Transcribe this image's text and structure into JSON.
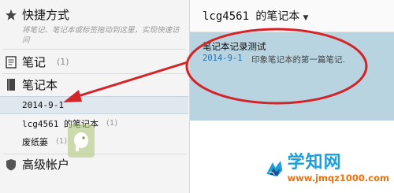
{
  "sidebar": {
    "shortcuts": {
      "title": "快捷方式",
      "hint": "将笔记、笔记本或标签拖动到这里，实现快速访问"
    },
    "notes": {
      "title": "笔记",
      "count": "(1)"
    },
    "notebooks": {
      "title": "笔记本",
      "items": [
        {
          "label": "2014-9-1",
          "count": ""
        },
        {
          "label": "lcg4561 的笔记本",
          "count": "(1)"
        },
        {
          "label": "废纸篓",
          "count": "(1)"
        }
      ]
    },
    "premium": {
      "title": "高级帐户"
    }
  },
  "main": {
    "notebook_title": "lcg4561 的笔记本",
    "notes": [
      {
        "title": "笔记本记录测试",
        "date": "2014-9-1",
        "snippet": "印象笔记本的第一篇笔记."
      }
    ]
  },
  "watermark": {
    "name": "学知网",
    "url": "www.jmqz1000.com"
  },
  "colors": {
    "annotation": "#d3242a",
    "selected_note": "#b9d4e1",
    "link": "#1f6fb0",
    "watermark_blue": "#1b9fd9",
    "watermark_orange": "#e9720e"
  },
  "icons": {
    "shortcuts": "star-icon",
    "notes": "note-icon",
    "notebooks": "notebook-icon",
    "premium": "premium-icon",
    "dropdown": "caret-down-icon"
  }
}
